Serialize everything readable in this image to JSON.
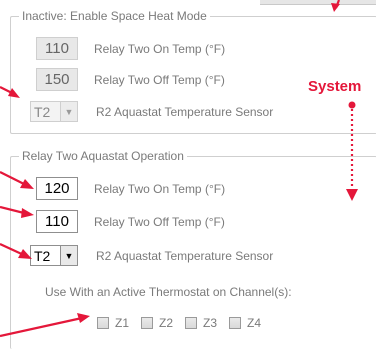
{
  "inactive_group": {
    "title": "Inactive: Enable Space Heat Mode",
    "on_temp": {
      "value": "110",
      "label": "Relay Two On Temp (°F)"
    },
    "off_temp": {
      "value": "150",
      "label": "Relay Two Off Temp (°F)"
    },
    "sensor": {
      "value": "T2",
      "label": "R2 Aquastat Temperature Sensor"
    }
  },
  "aquastat_group": {
    "title": "Relay Two Aquastat Operation",
    "on_temp": {
      "value": "120",
      "label": "Relay Two On Temp (°F)"
    },
    "off_temp": {
      "value": "110",
      "label": "Relay Two Off Temp (°F)"
    },
    "sensor": {
      "value": "T2",
      "label": "R2 Aquastat Temperature Sensor"
    },
    "thermostat_note": "Use With an Active Thermostat on Channel(s):",
    "channels": [
      "Z1",
      "Z2",
      "Z3",
      "Z4"
    ]
  },
  "annotation": {
    "label": "System",
    "color": "#e4173a"
  }
}
